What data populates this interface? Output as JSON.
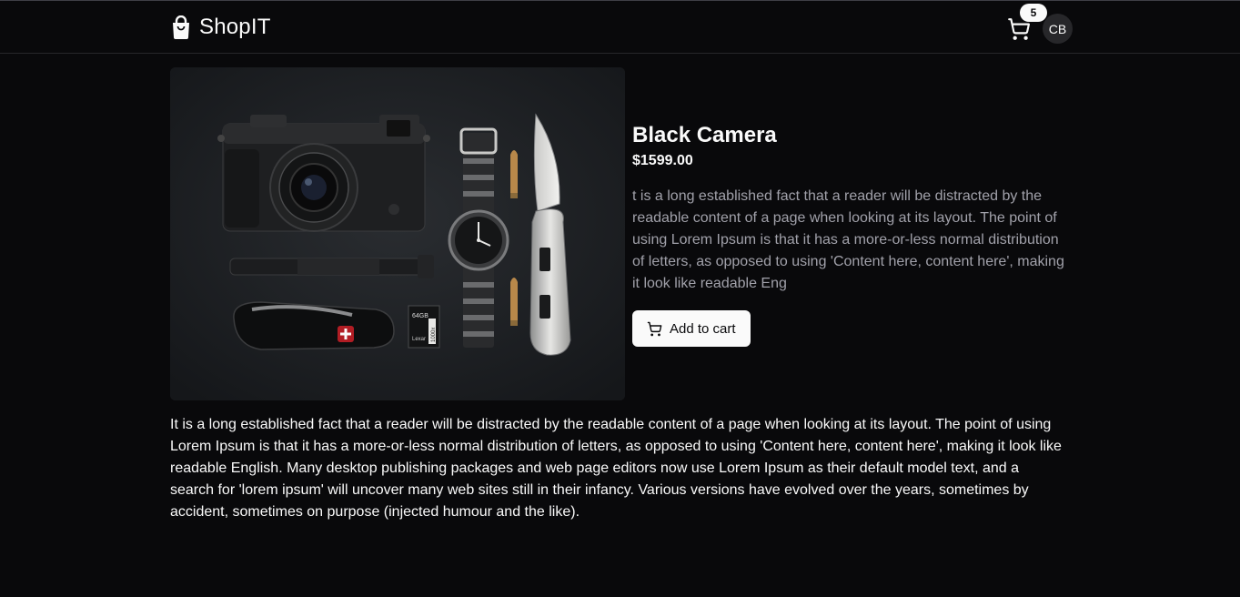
{
  "header": {
    "brand_name": "ShopIT",
    "brand_icon": "shopping-bag-icon",
    "cart_icon": "shopping-cart-icon",
    "cart_count": "5",
    "avatar_initials": "CB"
  },
  "product": {
    "title": "Black Camera",
    "price": "$1599.00",
    "short_description": "t is a long established fact that a reader will be distracted by the readable content of a page when looking at its layout. The point of using Lorem Ipsum is that it has a more-or-less normal distribution of letters, as opposed to using 'Content here, content here', making it look like readable Eng",
    "add_to_cart_label": "Add to cart",
    "add_to_cart_icon": "shopping-cart-icon",
    "long_description": "It is a long established fact that a reader will be distracted by the readable content of a page when looking at its layout. The point of using Lorem Ipsum is that it has a more-or-less normal distribution of letters, as opposed to using 'Content here, content here', making it look like readable English. Many desktop publishing packages and web page editors now use Lorem Ipsum as their default model text, and a search for 'lorem ipsum' will uncover many web sites still in their infancy. Various versions have evolved over the years, sometimes by accident, sometimes on purpose (injected humour and the like).",
    "image_label_sd": "64GB",
    "image_label_sd_brand": "Lexar",
    "image_label_sd_speed": "1000x"
  },
  "colors": {
    "background": "#09090b",
    "foreground": "#fafafa",
    "muted": "#a1a1aa",
    "border": "#27272a"
  }
}
